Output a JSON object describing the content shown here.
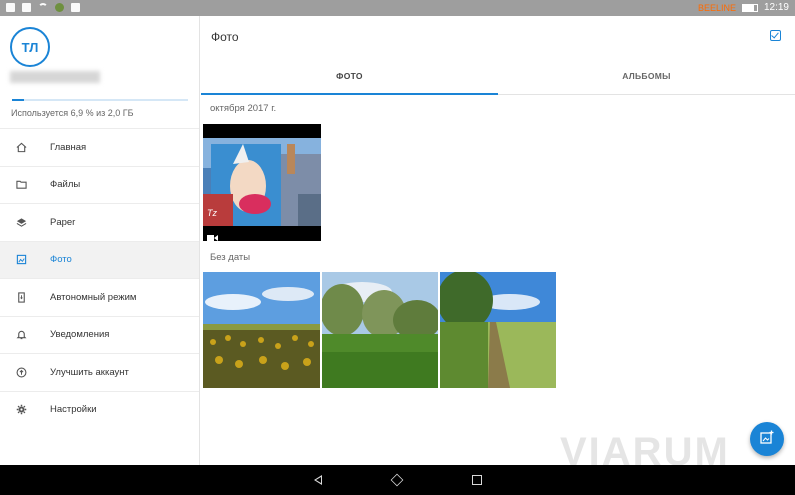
{
  "status_bar": {
    "carrier": "BEELINE",
    "time": "12:19"
  },
  "sidebar": {
    "avatar_initials": "ТЛ",
    "usage_text": "Используется 6,9 % из 2,0 ГБ",
    "usage_fraction": 0.069,
    "items": [
      {
        "label": "Главная",
        "icon": "home-icon"
      },
      {
        "label": "Файлы",
        "icon": "folder-icon"
      },
      {
        "label": "Paper",
        "icon": "layers-icon"
      },
      {
        "label": "Фото",
        "icon": "photo-icon",
        "active": true
      },
      {
        "label": "Автономный режим",
        "icon": "offline-icon"
      },
      {
        "label": "Уведомления",
        "icon": "bell-icon"
      },
      {
        "label": "Улучшить аккаунт",
        "icon": "upgrade-icon"
      },
      {
        "label": "Настройки",
        "icon": "gear-icon"
      }
    ]
  },
  "main": {
    "title": "Фото",
    "tabs": [
      {
        "label": "ФОТО",
        "active": true
      },
      {
        "label": "АЛЬБОМЫ",
        "active": false
      }
    ],
    "sections": [
      {
        "label": "октября 2017 г.",
        "items": [
          {
            "type": "video"
          }
        ]
      },
      {
        "label": "Без даты",
        "items": [
          {
            "type": "photo"
          },
          {
            "type": "photo"
          },
          {
            "type": "photo"
          }
        ]
      }
    ]
  },
  "watermark": "VIARUM",
  "colors": {
    "accent": "#1a84d6",
    "statusbar": "#9e9e9e",
    "navbar": "#000000"
  }
}
